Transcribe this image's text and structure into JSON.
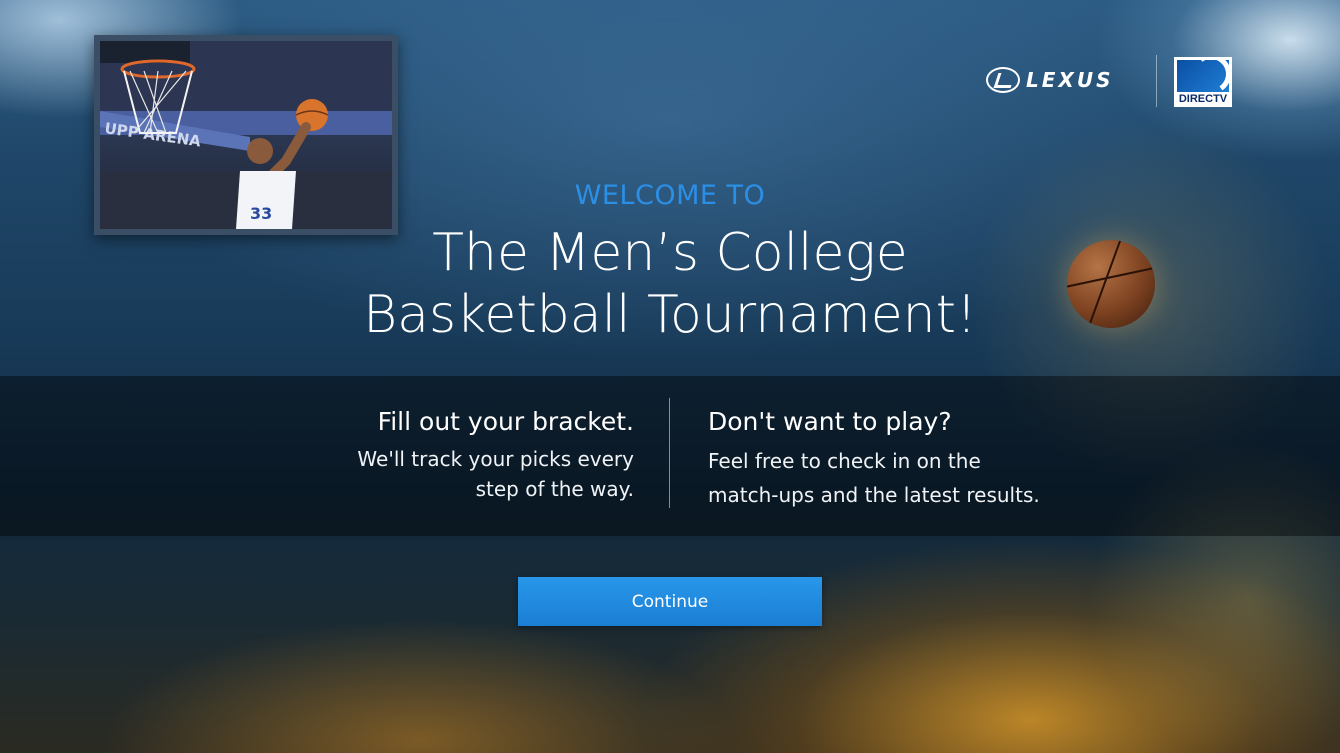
{
  "hero_image": {
    "arena_sign": "UPP ARENA",
    "jersey_number": "33"
  },
  "sponsors": {
    "lexus": "LEXUS",
    "directv": "DIRECTV"
  },
  "welcome": "WELCOME TO",
  "title": {
    "line1": "The Men’s College",
    "line2": "Basketball Tournament!"
  },
  "left": {
    "heading": "Fill out your bracket.",
    "body_line1": "We'll track your picks every",
    "body_line2": "step of the way."
  },
  "right": {
    "heading": "Don't want to play?",
    "body_line1": "Feel free to check in on the",
    "body_line2": "match-ups and the latest results."
  },
  "continue_label": "Continue",
  "colors": {
    "accent": "#2c8fe6",
    "button": "#1f86dc"
  }
}
